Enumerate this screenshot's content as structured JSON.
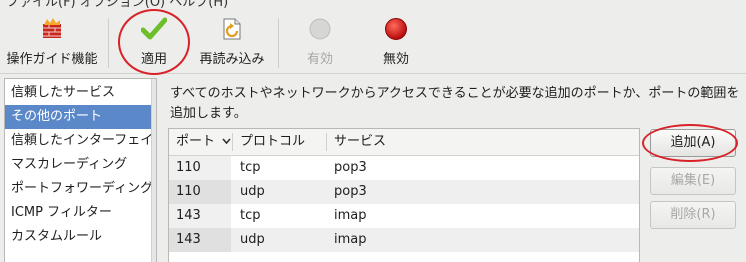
{
  "menubar": {
    "text": "ファイル(F)  オプション(O)  ヘルプ(H)"
  },
  "toolbar": {
    "items": [
      {
        "label": "操作ガイド機能",
        "icon": "firewall-wizard-icon",
        "enabled": true
      },
      {
        "label": "適用",
        "icon": "checkmark-icon",
        "enabled": true
      },
      {
        "label": "再読み込み",
        "icon": "reload-icon",
        "enabled": true
      },
      {
        "label": "有効",
        "icon": "enable-circle-icon",
        "enabled": false
      },
      {
        "label": "無効",
        "icon": "disable-red-circle-icon",
        "enabled": true
      }
    ]
  },
  "sidebar": {
    "items": [
      {
        "label": "信頼したサービス",
        "selected": false
      },
      {
        "label": "その他のポート",
        "selected": true
      },
      {
        "label": "信頼したインターフェイス",
        "selected": false
      },
      {
        "label": "マスカレーディング",
        "selected": false
      },
      {
        "label": "ポートフォワーディング",
        "selected": false
      },
      {
        "label": "ICMP フィルター",
        "selected": false
      },
      {
        "label": "カスタムルール",
        "selected": false
      }
    ]
  },
  "main": {
    "description": "すべてのホストやネットワークからアクセスできることが必要な追加のポートか、ポートの範囲を追加します。",
    "table": {
      "columns": [
        "ポート",
        "プロトコル",
        "サービス"
      ],
      "sort_indicator": "chevron-down-icon",
      "rows": [
        {
          "port": "110",
          "protocol": "tcp",
          "service": "pop3"
        },
        {
          "port": "110",
          "protocol": "udp",
          "service": "pop3"
        },
        {
          "port": "143",
          "protocol": "tcp",
          "service": "imap"
        },
        {
          "port": "143",
          "protocol": "udp",
          "service": "imap"
        }
      ]
    },
    "buttons": {
      "add": "追加(A)",
      "edit": "編集(E)",
      "delete": "削除(R)"
    }
  },
  "colors": {
    "selection": "#5b88c9",
    "annotation": "#d8222a",
    "check_green": "#6cbf2a",
    "disable_red": "#d41010"
  }
}
